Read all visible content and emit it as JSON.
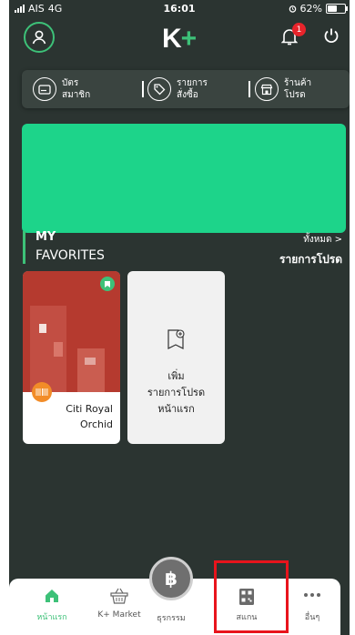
{
  "status_bar": {
    "carrier": "AIS",
    "network": "4G",
    "time": "16:01",
    "battery": "62%",
    "battery_level": 0.62
  },
  "header": {
    "logo_k": "K",
    "logo_plus": "+",
    "notification_count": "1"
  },
  "quick_menu": [
    {
      "line1": "บัตร",
      "line2": "สมาชิก",
      "icon": "card-icon"
    },
    {
      "line1": "รายการ",
      "line2": "สั่งซื้อ",
      "icon": "tag-icon"
    },
    {
      "line1": "ร้านค้า",
      "line2": "โปรด",
      "icon": "store-icon"
    }
  ],
  "favorites": {
    "title_top": "MY",
    "title_bottom": "FAVORITES",
    "view_all": "ทั้งหมด >",
    "promo_list": "รายการโปรด",
    "cards": [
      {
        "name_line1": "Citi Royal",
        "name_line2": "Orchid"
      }
    ],
    "add_card": {
      "line1": "เพิ่ม",
      "line2": "รายการโปรด",
      "line3": "หน้าแรก"
    }
  },
  "bottom_nav": {
    "items": [
      {
        "label": "หน้าแรก",
        "icon": "home-icon"
      },
      {
        "label": "K+ Market",
        "icon": "basket-icon"
      },
      {
        "label": "ธุรกรรม",
        "icon": "baht-icon"
      },
      {
        "label": "สแกน",
        "icon": "qr-scan-icon"
      },
      {
        "label": "อื่นๆ",
        "icon": "more-icon"
      }
    ],
    "fab_symbol": "฿"
  },
  "colors": {
    "background": "#2b3431",
    "accent": "#3dc178",
    "banner": "#1dd48a",
    "card_image": "#b53a2f",
    "highlight": "#e8141c"
  }
}
